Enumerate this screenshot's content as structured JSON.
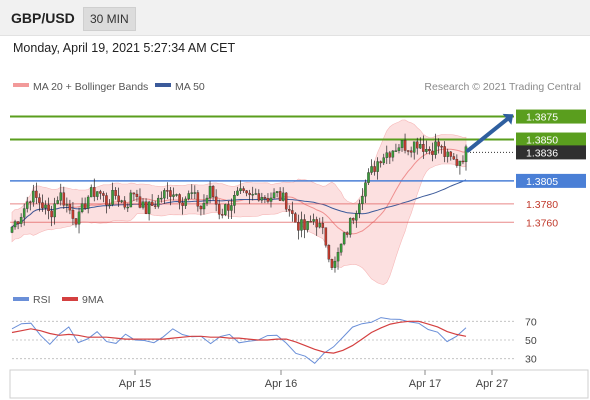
{
  "header": {
    "pair": "GBP/USD",
    "timeframe": "30 MIN"
  },
  "subtitle": "Monday, April 19, 2021 5:27:34 AM CET",
  "legend": {
    "bb_label": "MA 20 + Bollinger Bands",
    "ma_label": "MA 50",
    "watermark": "Research © 2021 Trading Central"
  },
  "rsi_legend": {
    "rsi_label": "RSI",
    "ma_label": "9MA"
  },
  "colors": {
    "green": "#5a9e1e",
    "blue": "#4a7fd6",
    "red": "#e05555",
    "dark": "#2f2f2f",
    "bb_fill": "#fbd5d5",
    "ma50": "#3b5a9a",
    "ma20": "#ef8f8f",
    "arrow": "#2f5f9f",
    "rsi_line": "#6a8fd8",
    "rsi_ma": "#d44040"
  },
  "chart_data": [
    {
      "type": "candlestick",
      "title": "GBP/USD 30 MIN",
      "ylim": [
        1.3695,
        1.3893
      ],
      "x_ticks": [
        "Apr 15",
        "Apr 16",
        "Apr 17",
        "Apr 27"
      ],
      "series_labels": [
        "MA 20 + Bollinger Bands",
        "MA 50"
      ],
      "levels": [
        {
          "value": 1.3875,
          "label": "1.3875",
          "style": "green-box"
        },
        {
          "value": 1.385,
          "label": "1.3850",
          "style": "green-box"
        },
        {
          "value": 1.3836,
          "label": "1.3836",
          "style": "current-price"
        },
        {
          "value": 1.3805,
          "label": "1.3805",
          "style": "blue-box"
        },
        {
          "value": 1.378,
          "label": "1.3780",
          "style": "red-text"
        },
        {
          "value": 1.376,
          "label": "1.3760",
          "style": "red-text"
        }
      ],
      "close_path": [
        1.3755,
        1.377,
        1.379,
        1.3782,
        1.3768,
        1.3792,
        1.3775,
        1.3762,
        1.3788,
        1.3795,
        1.3782,
        1.379,
        1.3778,
        1.3795,
        1.3772,
        1.378,
        1.379,
        1.3795,
        1.3785,
        1.379,
        1.3775,
        1.3795,
        1.377,
        1.378,
        1.379,
        1.3785,
        1.3792,
        1.3787,
        1.379,
        1.3782,
        1.376,
        1.3752,
        1.3765,
        1.3745,
        1.371,
        1.374,
        1.3765,
        1.3795,
        1.3815,
        1.3832,
        1.3838,
        1.3845,
        1.3843,
        1.3848,
        1.3838,
        1.3845,
        1.383,
        1.3825,
        1.3836
      ],
      "annotation": "arrow toward 1.3875"
    },
    {
      "type": "line",
      "title": "RSI",
      "ylim": [
        20,
        80
      ],
      "y_ticks": [
        70,
        50,
        30
      ],
      "series": [
        {
          "name": "RSI",
          "values": [
            62,
            66,
            70,
            54,
            45,
            58,
            62,
            48,
            52,
            57,
            50,
            46,
            55,
            52,
            48,
            47,
            55,
            60,
            57,
            54,
            52,
            48,
            53,
            55,
            49,
            47,
            50,
            56,
            53,
            48,
            36,
            31,
            27,
            35,
            42,
            55,
            62,
            68,
            70,
            72,
            74,
            72,
            68,
            70,
            60,
            58,
            50,
            52,
            64
          ]
        },
        {
          "name": "9MA",
          "values": [
            58,
            60,
            62,
            60,
            57,
            55,
            56,
            55,
            53,
            53,
            53,
            52,
            51,
            51,
            51,
            51,
            51,
            52,
            53,
            54,
            54,
            53,
            53,
            52,
            52,
            51,
            50,
            50,
            51,
            51,
            48,
            44,
            40,
            37,
            36,
            39,
            44,
            51,
            58,
            63,
            67,
            69,
            70,
            70,
            67,
            64,
            59,
            56,
            54
          ]
        }
      ]
    }
  ]
}
